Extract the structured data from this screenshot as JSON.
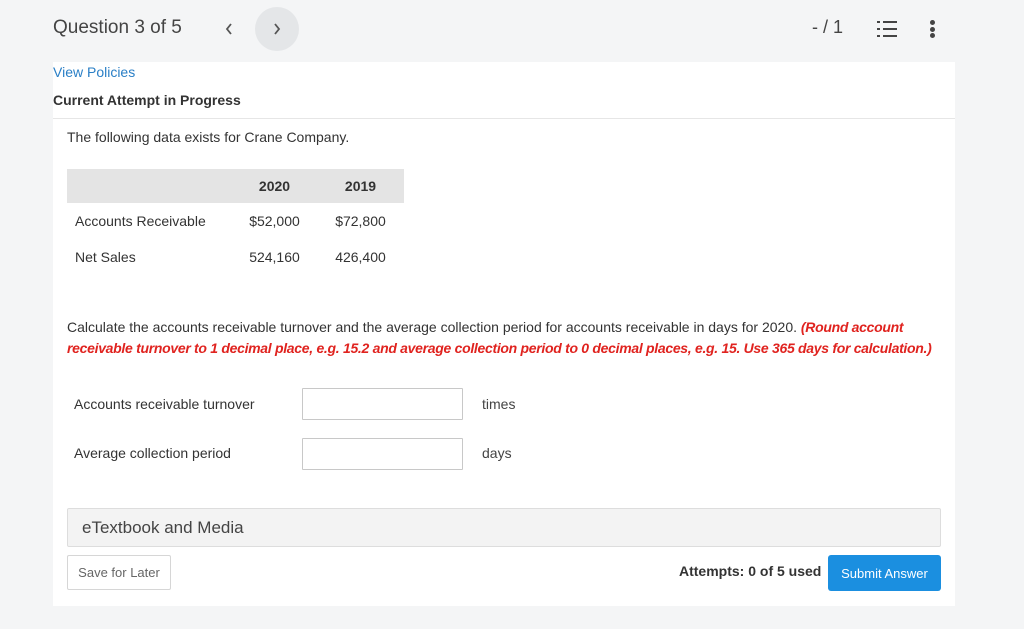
{
  "header": {
    "question_label": "Question 3 of 5",
    "prev_icon": "chevron-left-icon",
    "next_icon": "chevron-right-icon",
    "score": "- / 1",
    "list_icon": "numbered-list-icon",
    "more_icon": "vertical-ellipsis-icon"
  },
  "policies_link": "View Policies",
  "attempt_status": "Current Attempt in Progress",
  "question": {
    "intro": "The following data exists for Crane Company.",
    "table": {
      "columns": [
        "",
        "2020",
        "2019"
      ],
      "rows": [
        {
          "label": "Accounts Receivable",
          "y2020": "$52,000",
          "y2019": "$72,800"
        },
        {
          "label": "Net Sales",
          "y2020": "524,160",
          "y2019": "426,400"
        }
      ]
    },
    "instruction": "Calculate the accounts receivable turnover and the average collection period for accounts receivable in days for 2020.",
    "note": "(Round account receivable turnover to 1 decimal place, e.g. 15.2 and average collection period to 0 decimal places, e.g. 15. Use 365 days for calculation.)",
    "fields": [
      {
        "label": "Accounts receivable turnover",
        "value": "",
        "unit": "times"
      },
      {
        "label": "Average collection period",
        "value": "",
        "unit": "days"
      }
    ]
  },
  "etextbook_label": "eTextbook and Media",
  "footer": {
    "save_label": "Save for Later",
    "attempts_text": "Attempts: 0 of 5 used",
    "submit_label": "Submit Answer"
  },
  "colors": {
    "accent": "#1b8fe0",
    "link": "#2a7fc6",
    "note_red": "#e0231f"
  }
}
